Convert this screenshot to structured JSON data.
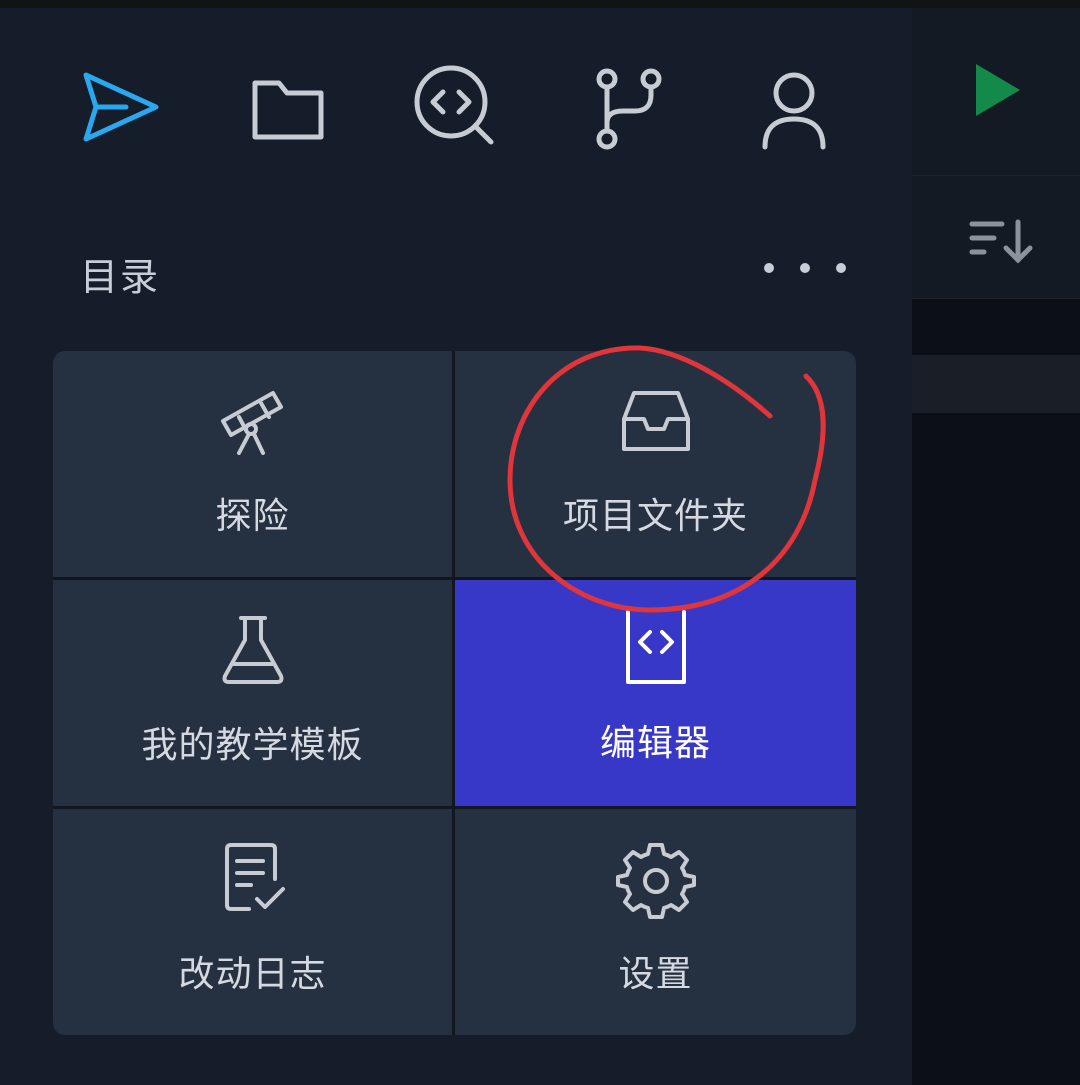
{
  "top_icons": [
    {
      "name": "send-icon",
      "color": "#29a8f0"
    },
    {
      "name": "folder-icon",
      "color": "#c7ccd4"
    },
    {
      "name": "code-search-icon",
      "color": "#c7ccd4"
    },
    {
      "name": "git-branch-icon",
      "color": "#c7ccd4"
    },
    {
      "name": "user-icon",
      "color": "#c7ccd4"
    }
  ],
  "section": {
    "title": "目录",
    "more_icon": "more-horizontal-icon"
  },
  "tiles": [
    {
      "label": "探险",
      "icon": "telescope-icon",
      "active": false
    },
    {
      "label": "项目文件夹",
      "icon": "inbox-icon",
      "active": false
    },
    {
      "label": "我的教学模板",
      "icon": "flask-icon",
      "active": false
    },
    {
      "label": "编辑器",
      "icon": "code-file-icon",
      "active": true
    },
    {
      "label": "改动日志",
      "icon": "changelog-icon",
      "active": false
    },
    {
      "label": "设置",
      "icon": "gear-icon",
      "active": false
    }
  ],
  "right_panel": {
    "play_icon": "play-icon",
    "sort_icon": "sort-descending-icon",
    "play_color": "#138a4a"
  },
  "colors": {
    "panel_bg": "#151d2a",
    "tile_bg": "#253041",
    "active_tile_bg": "#3838c8",
    "annotation_red": "#e0353b"
  }
}
